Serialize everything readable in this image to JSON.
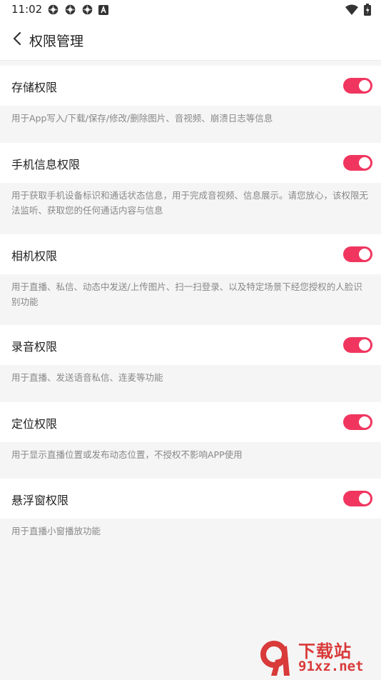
{
  "status_bar": {
    "time": "11:02",
    "icons": [
      "settings-gear-icon",
      "settings-gear-icon",
      "settings-gear-icon",
      "text-a-icon"
    ],
    "right_icons": [
      "wifi-icon",
      "battery-charging-icon"
    ]
  },
  "header": {
    "title": "权限管理",
    "back_icon": "chevron-left-icon"
  },
  "permissions": [
    {
      "title": "存储权限",
      "enabled": true,
      "description": "用于App写入/下载/保存/修改/删除图片、音视频、崩溃日志等信息"
    },
    {
      "title": "手机信息权限",
      "enabled": true,
      "description": "用于获取手机设备标识和通话状态信息，用于完成音视频、信息展示。请您放心，该权限无法监听、获取您的任何通话内容与信息"
    },
    {
      "title": "相机权限",
      "enabled": true,
      "description": "用于直播、私信、动态中发送/上传图片、扫一扫登录、以及特定场景下经您授权的人脸识别功能"
    },
    {
      "title": "录音权限",
      "enabled": true,
      "description": "用于直播、发送语音私信、连麦等功能"
    },
    {
      "title": "定位权限",
      "enabled": true,
      "description": "用于显示直播位置或发布动态位置，不授权不影响APP使用"
    },
    {
      "title": "悬浮窗权限",
      "enabled": true,
      "description": "用于直播小窗播放功能"
    }
  ],
  "colors": {
    "accent": "#f0365f",
    "watermark": "#d93a3a"
  },
  "watermark": {
    "top": "下载站",
    "bottom": "91xz.net"
  }
}
